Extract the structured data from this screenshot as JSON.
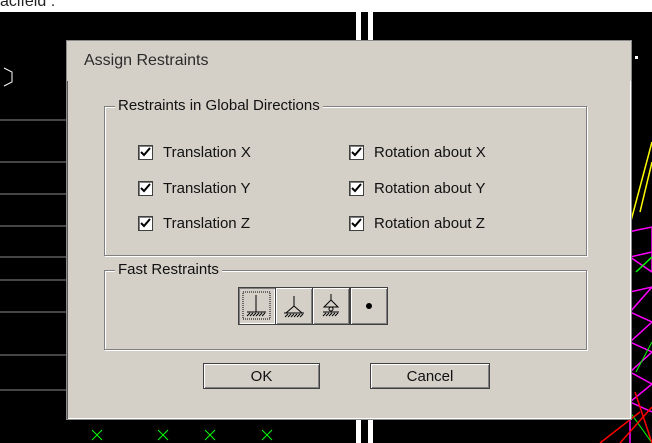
{
  "caption": "aclfeld :",
  "dialog": {
    "title": "Assign Restraints",
    "global_group": {
      "label": "Restraints in Global Directions",
      "checkboxes": [
        {
          "label": "Translation X",
          "checked": true
        },
        {
          "label": "Rotation about X",
          "checked": true
        },
        {
          "label": "Translation Y",
          "checked": true
        },
        {
          "label": "Rotation about Y",
          "checked": true
        },
        {
          "label": "Translation Z",
          "checked": true
        },
        {
          "label": "Rotation about Z",
          "checked": true
        }
      ]
    },
    "fast_group": {
      "label": "Fast Restraints",
      "buttons": [
        {
          "icon": "fixed-support-icon",
          "pressed": true
        },
        {
          "icon": "pinned-support-icon",
          "pressed": false
        },
        {
          "icon": "roller-support-icon",
          "pressed": false
        },
        {
          "icon": "free-node-icon",
          "pressed": false
        }
      ]
    },
    "ok_label": "OK",
    "cancel_label": "Cancel"
  },
  "colors": {
    "dialog_face": "#d4d0c8",
    "viewport_bg": "#000000",
    "member_magenta": "#ff00ff",
    "member_yellow": "#ffff00",
    "member_green": "#00ff00",
    "member_red": "#ff0000"
  }
}
